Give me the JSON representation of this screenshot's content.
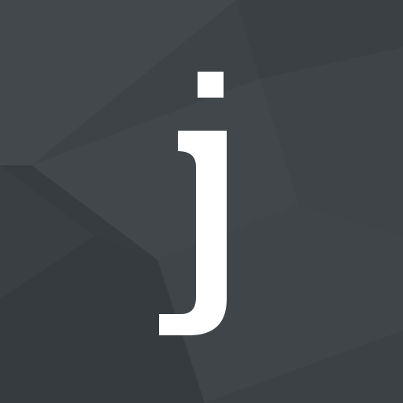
{
  "app_icon": {
    "glyph": "j",
    "glyph_color": "#ffffff",
    "background_color": "#3c4245",
    "background_style": "faceted-polygon"
  }
}
